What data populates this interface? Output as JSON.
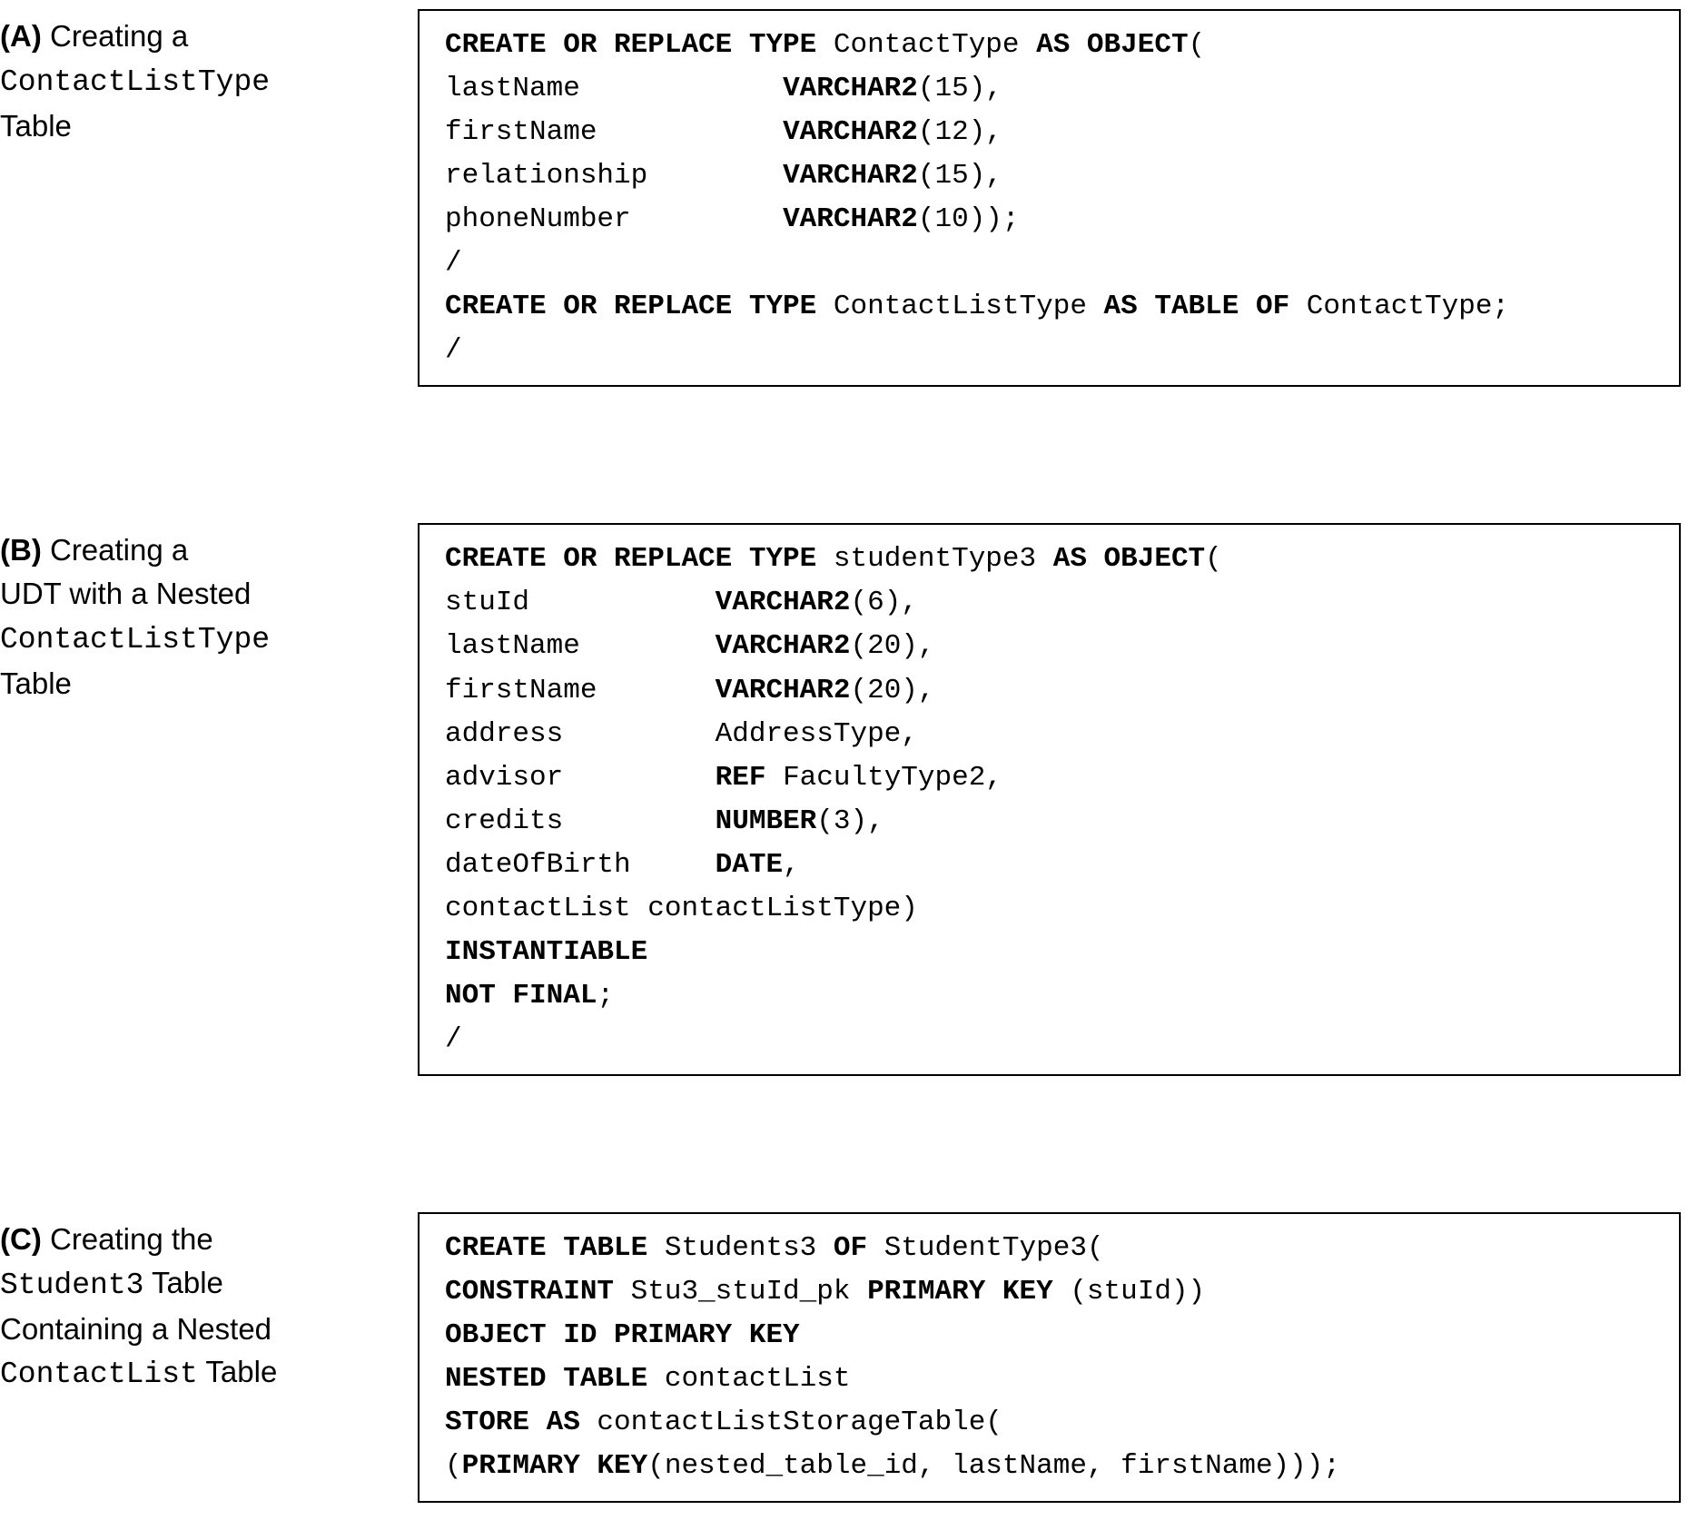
{
  "sections": [
    {
      "letter": "(A)",
      "label_html": "  Creating a<br><span class=\"mono\">ContactListType</span><br>Table",
      "code_html": "<span class=\"b\">CREATE OR REPLACE TYPE</span> ContactType <span class=\"b\">AS OBJECT</span>(\nlastName            <span class=\"b\">VARCHAR2</span>(15),\nfirstName           <span class=\"b\">VARCHAR2</span>(12),\nrelationship        <span class=\"b\">VARCHAR2</span>(15),\nphoneNumber         <span class=\"b\">VARCHAR2</span>(10));\n/\n<span class=\"b\">CREATE OR REPLACE TYPE</span> ContactListType <span class=\"b\">AS TABLE OF</span> ContactType;\n/"
    },
    {
      "letter": "(B)",
      "label_html": "  Creating a<br>UDT with a Nested<br><span class=\"mono\">ContactListType</span><br>Table",
      "code_html": "<span class=\"b\">CREATE OR REPLACE TYPE</span> studentType3 <span class=\"b\">AS OBJECT</span>(\nstuId           <span class=\"b\">VARCHAR2</span>(6),\nlastName        <span class=\"b\">VARCHAR2</span>(20),\nfirstName       <span class=\"b\">VARCHAR2</span>(20),\naddress         AddressType,\nadvisor         <span class=\"b\">REF</span> FacultyType2,\ncredits         <span class=\"b\">NUMBER</span>(3),\ndateOfBirth     <span class=\"b\">DATE</span>,\ncontactList contactListType)\n<span class=\"b\">INSTANTIABLE</span>\n<span class=\"b\">NOT FINAL</span>;\n/"
    },
    {
      "letter": "(C)",
      "label_html": "  Creating the<br><span class=\"mono\">Student3</span> Table<br>Containing a Nested<br><span class=\"mono\">ContactList</span> Table",
      "code_html": "<span class=\"b\">CREATE TABLE</span> Students3 <span class=\"b\">OF</span> StudentType3(\n<span class=\"b\">CONSTRAINT</span> Stu3_stuId_pk <span class=\"b\">PRIMARY KEY</span> (stuId))\n<span class=\"b\">OBJECT ID PRIMARY KEY</span>\n<span class=\"b\">NESTED TABLE</span> contactList\n<span class=\"b\">STORE AS</span> contactListStorageTable(\n(<span class=\"b\">PRIMARY KEY</span>(nested_table_id, lastName, firstName)));"
    }
  ]
}
